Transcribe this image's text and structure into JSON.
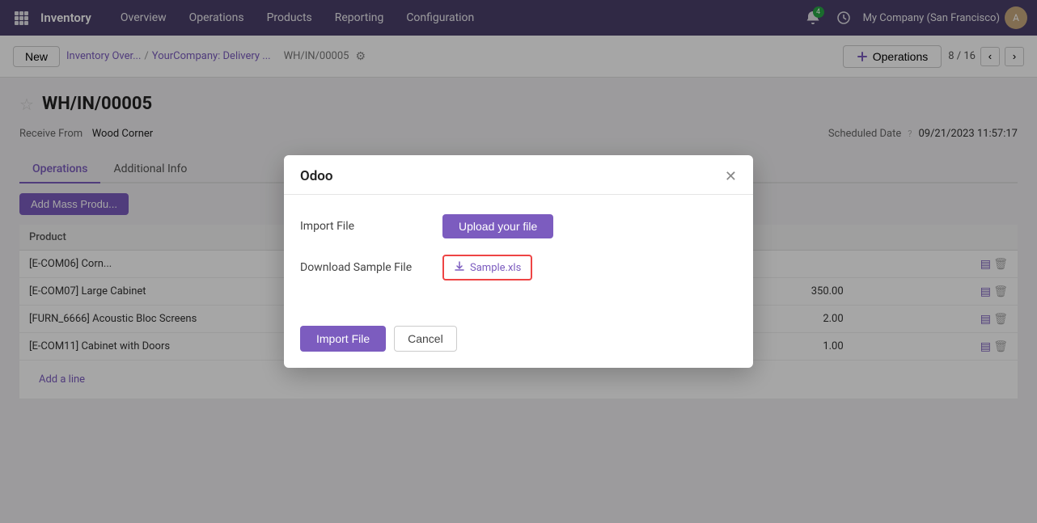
{
  "topnav": {
    "brand": "Inventory",
    "items": [
      "Overview",
      "Operations",
      "Products",
      "Reporting",
      "Configuration"
    ],
    "notif_count": "4",
    "company": "My Company (San Francisco)",
    "avatar_initials": "A"
  },
  "breadcrumb": {
    "new_label": "New",
    "parent1": "Inventory Over...",
    "sep1": "/",
    "parent2": "YourCompany: Delivery ...",
    "wh_number": "WH/IN/00005",
    "operations_btn": "Operations",
    "pager_current": "8",
    "pager_total": "16"
  },
  "record": {
    "title": "WH/IN/00005",
    "receive_from_label": "Receive From",
    "receive_from_value": "Wood Corner",
    "scheduled_date_label": "Scheduled Date",
    "scheduled_date_help": "?",
    "scheduled_date_value": "09/21/2023 11:57:17"
  },
  "tabs": [
    {
      "label": "Operations",
      "active": true
    },
    {
      "label": "Additional Info",
      "active": false
    }
  ],
  "table": {
    "add_mass_label": "Add Mass Produ...",
    "col_product": "Product",
    "rows": [
      {
        "product": "[E-COM06] Corn...",
        "qty": null,
        "has_forecast": true
      },
      {
        "product": "[E-COM07] Large Cabinet",
        "qty": "350.00",
        "has_forecast": true
      },
      {
        "product": "[FURN_6666] Acoustic Bloc Screens",
        "qty": "2.00",
        "has_forecast": true
      },
      {
        "product": "[E-COM11] Cabinet with Doors",
        "qty": "1.00",
        "has_forecast": true
      }
    ],
    "add_line_label": "Add a line"
  },
  "modal": {
    "title": "Odoo",
    "import_file_label": "Import File",
    "upload_btn": "Upload your file",
    "download_sample_label": "Download Sample File",
    "sample_file_name": "Sample.xls",
    "import_btn": "Import File",
    "cancel_btn": "Cancel"
  }
}
